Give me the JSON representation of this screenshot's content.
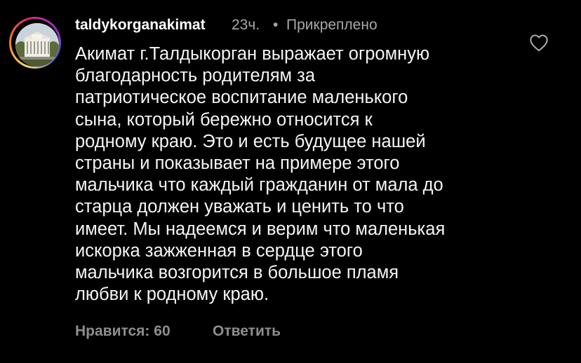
{
  "comment": {
    "username": "taldykorganakimat",
    "time": "23ч.",
    "separator": "•",
    "pinned_label": "Прикреплено",
    "text_lines": [
      "Акимат г.Талдыкорган выражает огромную",
      "благодарность родителям за",
      "патриотическое воспитание маленького",
      "сына, который бережно относится к",
      "родному краю. Это и есть будущее нашей",
      "страны и показывает на примере этого",
      "мальчика что каждый гражданин от мала до",
      "старца должен уважать и ценить то что",
      "имеет. Мы надеемся и верим что маленькая",
      "искорка зажженная в сердце этого",
      "мальчика возгорится в большое пламя",
      "любви к родному краю."
    ],
    "likes_label": "Нравится: 60",
    "reply_label": "Ответить",
    "like_icon": "heart-outline-icon"
  },
  "colors": {
    "background": "#000000",
    "text_primary": "#ffffff",
    "text_secondary": "#a8a8a8",
    "action_text": "#8e8e8e"
  }
}
